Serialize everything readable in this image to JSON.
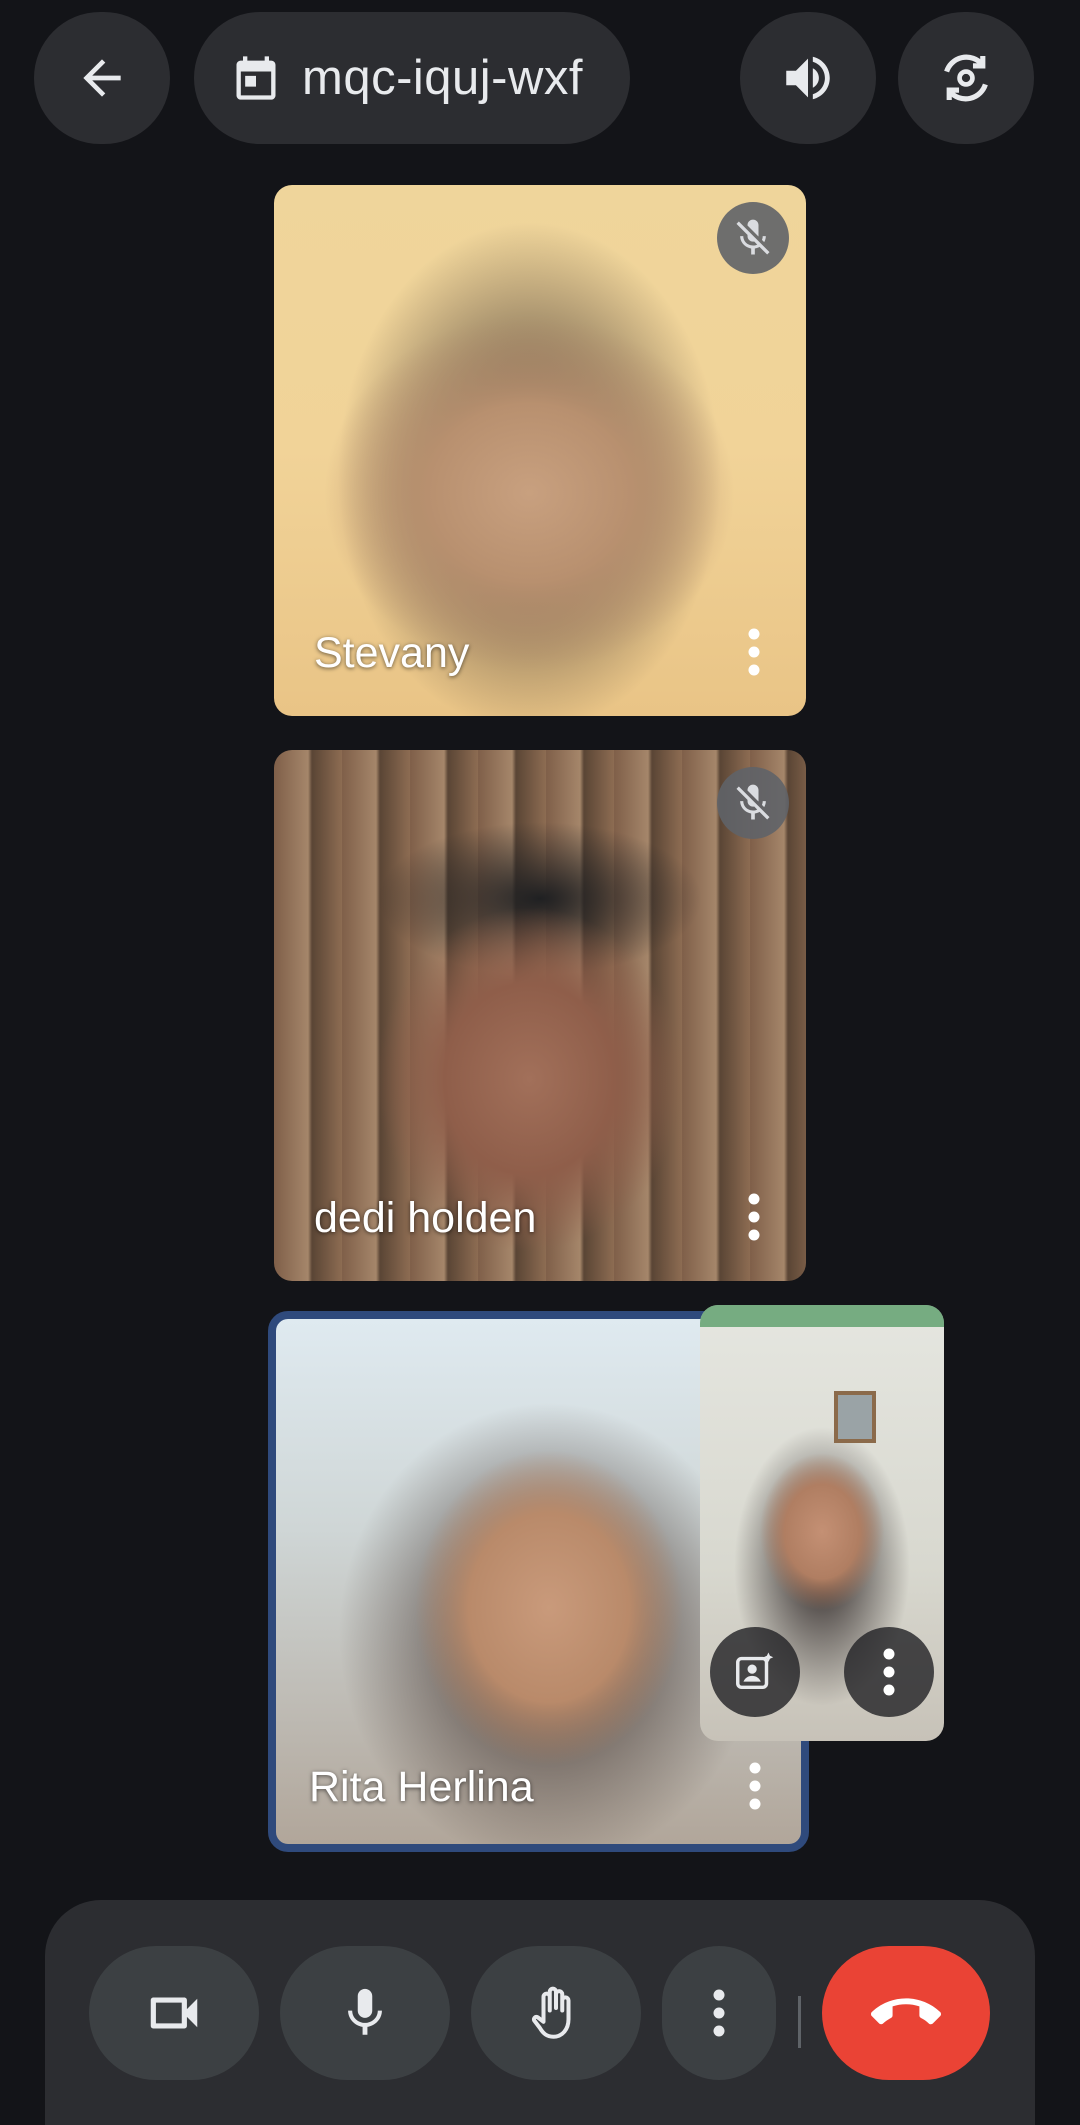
{
  "topbar": {
    "back_icon": "arrow-back-icon",
    "meeting_code": "mqc-iquj-wxf",
    "calendar_icon": "calendar-icon",
    "audio_icon": "volume-up-icon",
    "flip_camera_icon": "flip-camera-icon"
  },
  "participants": [
    {
      "name": "Stevany",
      "muted": true
    },
    {
      "name": "dedi holden",
      "muted": true
    },
    {
      "name": "Rita Herlina",
      "muted": false,
      "speaking": true
    }
  ],
  "self_view": {
    "effects_icon": "portrait-effects-icon",
    "more_icon": "more-vert-icon"
  },
  "controls": {
    "video_icon": "videocam-icon",
    "mic_icon": "mic-icon",
    "hand_icon": "raise-hand-icon",
    "more_icon": "more-vert-icon",
    "end_call_icon": "call-end-icon",
    "end_call_color": "#ea4335"
  },
  "colors": {
    "background": "#131418",
    "surface": "#2c2d31",
    "button": "#3c4043",
    "active_speaker_border": "#2f4a7c"
  }
}
